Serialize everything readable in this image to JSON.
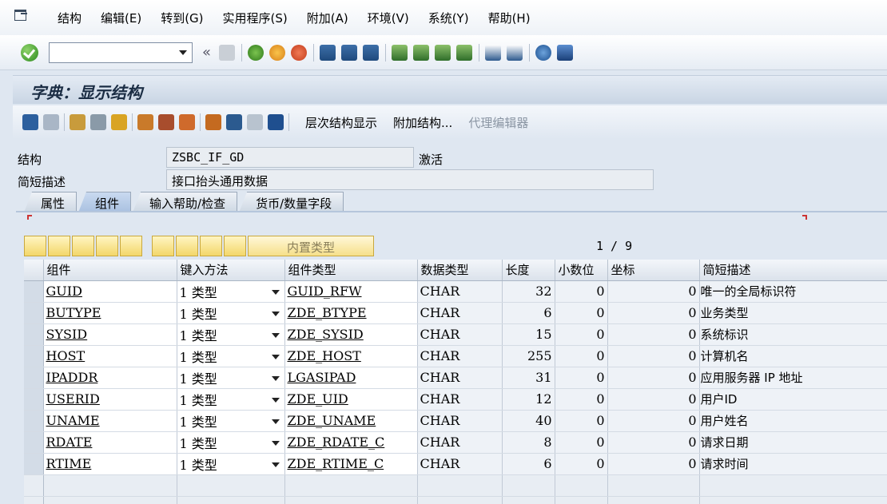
{
  "menu": [
    "结构",
    "编辑(E)",
    "转到(G)",
    "实用程序(S)",
    "附加(A)",
    "环境(V)",
    "系统(Y)",
    "帮助(H)"
  ],
  "toolbar": {
    "command_value": "",
    "back_more": "«"
  },
  "title": "字典：显示结构",
  "app_toolbar": {
    "hierarchy": "层次结构显示",
    "append": "附加结构...",
    "proxy_editor": "代理编辑器"
  },
  "fields": {
    "structure_label": "结构",
    "structure_value": "ZSBC_IF_GD",
    "status": "激活",
    "short_desc_label": "简短描述",
    "short_desc_value": "接口抬头通用数据"
  },
  "tabs": [
    "属性",
    "组件",
    "输入帮助/检查",
    "货币/数量字段"
  ],
  "table_tools": {
    "builtin_type": "内置类型",
    "counter": "1 / 9"
  },
  "columns": [
    "组件",
    "键入方法",
    "组件类型",
    "数据类型",
    "长度",
    "小数位",
    "坐标",
    "简短描述"
  ],
  "rows": [
    {
      "comp": "GUID",
      "method": "1 类型",
      "ctype": "GUID_RFW",
      "dtype": "CHAR",
      "len": "32",
      "dec": "0",
      "coord": "0",
      "desc": "唯一的全局标识符"
    },
    {
      "comp": "BUTYPE",
      "method": "1 类型",
      "ctype": "ZDE_BTYPE",
      "dtype": "CHAR",
      "len": "6",
      "dec": "0",
      "coord": "0",
      "desc": "业务类型"
    },
    {
      "comp": "SYSID",
      "method": "1 类型",
      "ctype": "ZDE_SYSID",
      "dtype": "CHAR",
      "len": "15",
      "dec": "0",
      "coord": "0",
      "desc": "系统标识"
    },
    {
      "comp": "HOST",
      "method": "1 类型",
      "ctype": "ZDE_HOST",
      "dtype": "CHAR",
      "len": "255",
      "dec": "0",
      "coord": "0",
      "desc": "计算机名"
    },
    {
      "comp": "IPADDR",
      "method": "1 类型",
      "ctype": "LGASIPAD",
      "dtype": "CHAR",
      "len": "31",
      "dec": "0",
      "coord": "0",
      "desc": "应用服务器 IP 地址"
    },
    {
      "comp": "USERID",
      "method": "1 类型",
      "ctype": "ZDE_UID",
      "dtype": "CHAR",
      "len": "12",
      "dec": "0",
      "coord": "0",
      "desc": "用户ID"
    },
    {
      "comp": "UNAME",
      "method": "1 类型",
      "ctype": "ZDE_UNAME",
      "dtype": "CHAR",
      "len": "40",
      "dec": "0",
      "coord": "0",
      "desc": "用户姓名"
    },
    {
      "comp": "RDATE",
      "method": "1 类型",
      "ctype": "ZDE_RDATE_C",
      "dtype": "CHAR",
      "len": "8",
      "dec": "0",
      "coord": "0",
      "desc": "请求日期"
    },
    {
      "comp": "RTIME",
      "method": "1 类型",
      "ctype": "ZDE_RTIME_C",
      "dtype": "CHAR",
      "len": "6",
      "dec": "0",
      "coord": "0",
      "desc": "请求时间"
    }
  ]
}
